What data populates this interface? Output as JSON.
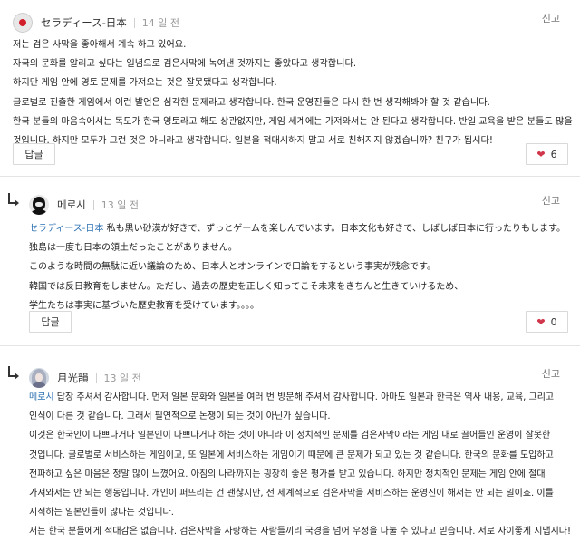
{
  "comments": [
    {
      "author": "セラディース-日本",
      "time": "14 일 전",
      "report_label": "신고",
      "lines": [
        "저는 검은 사막을 좋아해서 계속 하고 있어요.",
        "자국의 문화를 알리고 싶다는 일념으로 검은사막에 녹여낸 것까지는 좋았다고 생각합니다.",
        "하지만 게임 안에 영토 문제를 가져오는 것은 잘못됐다고 생각합니다.",
        "글로벌로 진출한 게임에서 이런 발언은 심각한 문제라고 생각합니다. 한국 운영진들은 다시 한 번 생각해봐야 할 것 같습니다.",
        "한국 분들의 마음속에서는 독도가 한국 영토라고 해도 상관없지만, 게임 세계에는 가져와서는 안 된다고 생각합니다. 반일 교육을 받은 분들도 많을",
        "것입니다. 하지만 모두가 그런 것은 아니라고 생각합니다. 일본을 적대시하지 말고 서로 친해지지 않겠습니까? 친구가 됩시다!"
      ],
      "reply_button": "답글",
      "likes": "6"
    },
    {
      "author": "메로시",
      "time": "13 일 전",
      "report_label": "신고",
      "mention": "セラディース-日本",
      "first_line_rest": " 私も黒い砂漠が好きで、ずっとゲームを楽しんでいます。日本文化も好きで、しばしば日本に行ったりもします。",
      "lines": [
        "独島は一度も日本の領土だったことがありません。",
        "このような時間の無駄に近い議論のため、日本人とオンラインで口論をするという事実が残念です。",
        "韓国では反日教育をしません。ただし、過去の歴史を正しく知ってこそ未来をきちんと生きていけるため、",
        "学生たちは事実に基づいた歴史教育を受けています。。。。"
      ],
      "reply_button": "답글",
      "likes": "0"
    },
    {
      "author": "月光韻",
      "time": "13 일 전",
      "report_label": "신고",
      "mention": "메로시",
      "first_line_rest": " 답장 주셔서 감사합니다. 먼저 일본 문화와 일본을 여러 번 방문해 주셔서 감사합니다. 아마도 일본과 한국은 역사 내용, 교육, 그리고",
      "lines": [
        "인식이 다른 것 같습니다. 그래서 필연적으로 논쟁이 되는 것이 아닌가 싶습니다.",
        "이것은 한국인이 나쁘다거나 일본인이 나쁘다거나 하는 것이 아니라 이 정치적인 문제를 검은사막이라는 게임 내로 끌어들인 운영이 잘못한",
        "것입니다. 글로벌로 서비스하는 게임이고, 또 일본에 서비스하는 게임이기 때문에 큰 문제가 되고 있는 것 같습니다. 한국의 문화를 도입하고",
        "전파하고 싶은 마음은 정말 많이 느꼈어요. 아침의 나라까지는 굉장히 좋은 평가를 받고 있습니다. 하지만 정치적인 문제는 게임 안에 절대",
        "가져와서는 안 되는 행동입니다. 개인이 퍼뜨리는 건 괜찮지만, 전 세계적으로 검은사막을 서비스하는 운영진이 해서는 안 되는 일이죠. 이를",
        "지적하는 일본인들이 많다는 것입니다.",
        "저는 한국 분들에게 적대감은 없습니다. 검은사막을 사랑하는 사람들끼리 국경을 넘어 우정을 나눌 수 있다고 믿습니다. 서로 사이좋게 지냅시다!"
      ]
    }
  ]
}
